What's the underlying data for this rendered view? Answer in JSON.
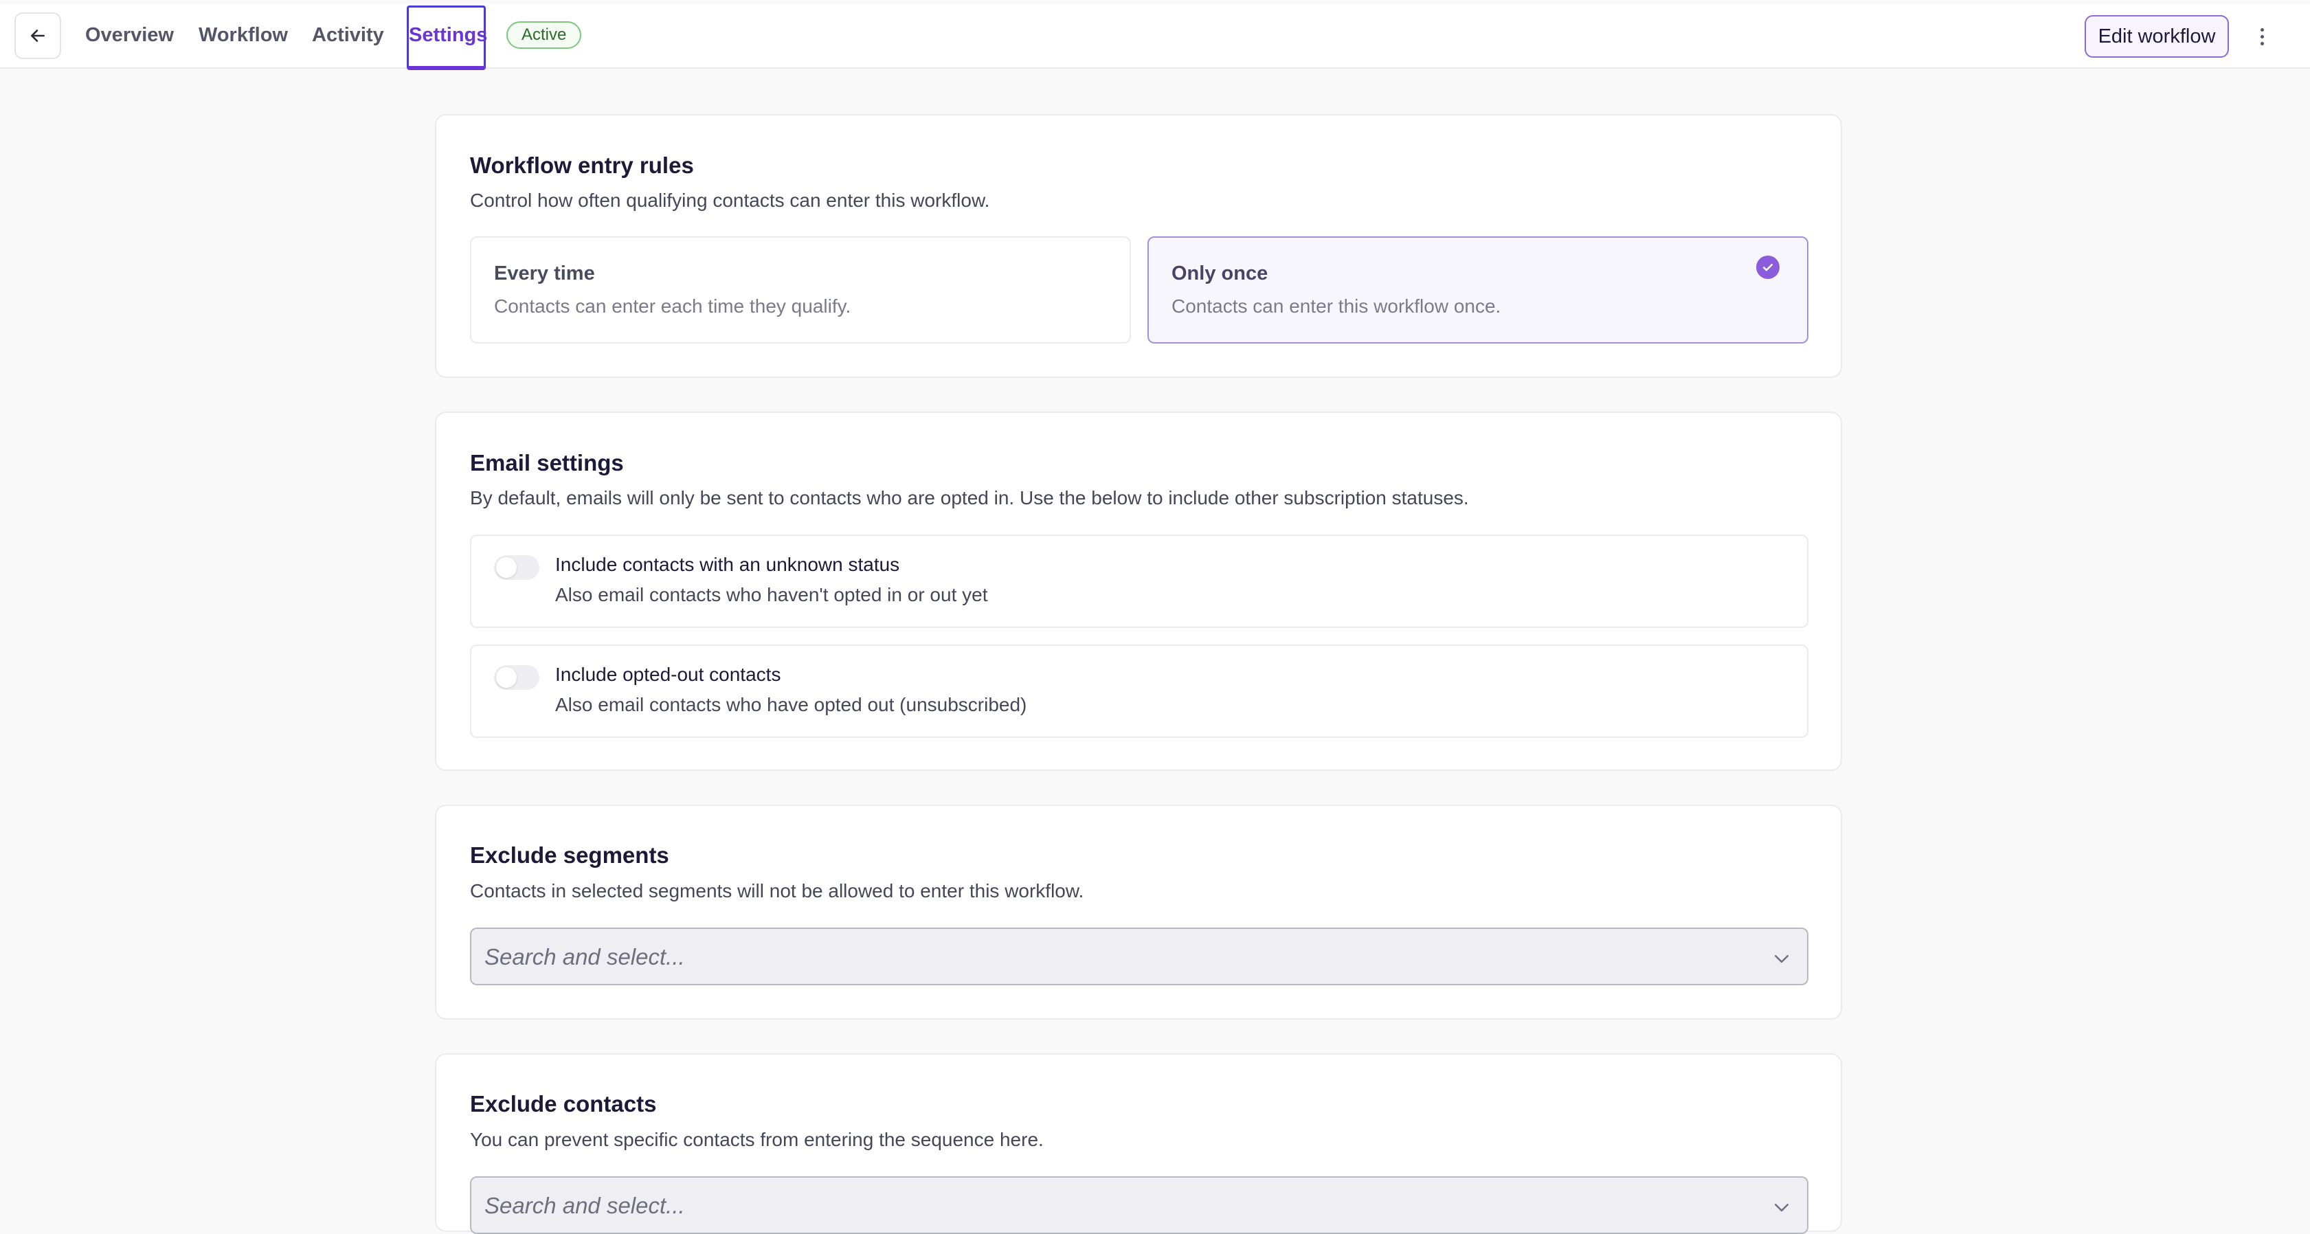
{
  "header": {
    "tabs": [
      {
        "label": "Overview"
      },
      {
        "label": "Workflow"
      },
      {
        "label": "Activity"
      },
      {
        "label": "Settings"
      }
    ],
    "active_tab": "Settings",
    "status_badge": "Active",
    "edit_button": "Edit workflow"
  },
  "entry_rules": {
    "title": "Workflow entry rules",
    "description": "Control how often qualifying contacts can enter this workflow.",
    "options": [
      {
        "title": "Every time",
        "description": "Contacts can enter each time they qualify.",
        "selected": false
      },
      {
        "title": "Only once",
        "description": "Contacts can enter this workflow once.",
        "selected": true
      }
    ]
  },
  "email_settings": {
    "title": "Email settings",
    "description": "By default, emails will only be sent to contacts who are opted in. Use the below to include other subscription statuses.",
    "toggles": [
      {
        "title": "Include contacts with an unknown status",
        "description": "Also email contacts who haven't opted in or out yet",
        "on": false
      },
      {
        "title": "Include opted-out contacts",
        "description": "Also email contacts who have opted out (unsubscribed)",
        "on": false
      }
    ]
  },
  "exclude_segments": {
    "title": "Exclude segments",
    "description": "Contacts in selected segments will not be allowed to enter this workflow.",
    "placeholder": "Search and select..."
  },
  "exclude_contacts": {
    "title": "Exclude contacts",
    "description": "You can prevent specific contacts from entering the sequence here.",
    "placeholder": "Search and select..."
  },
  "colors": {
    "accent": "#6b35d6",
    "selected_border": "#a58ee6",
    "badge_border": "#7fc77a"
  },
  "icons": {
    "back": "arrow-left-icon",
    "check": "check-circle-icon",
    "more": "more-vertical-icon",
    "chevron": "chevron-down-icon"
  }
}
